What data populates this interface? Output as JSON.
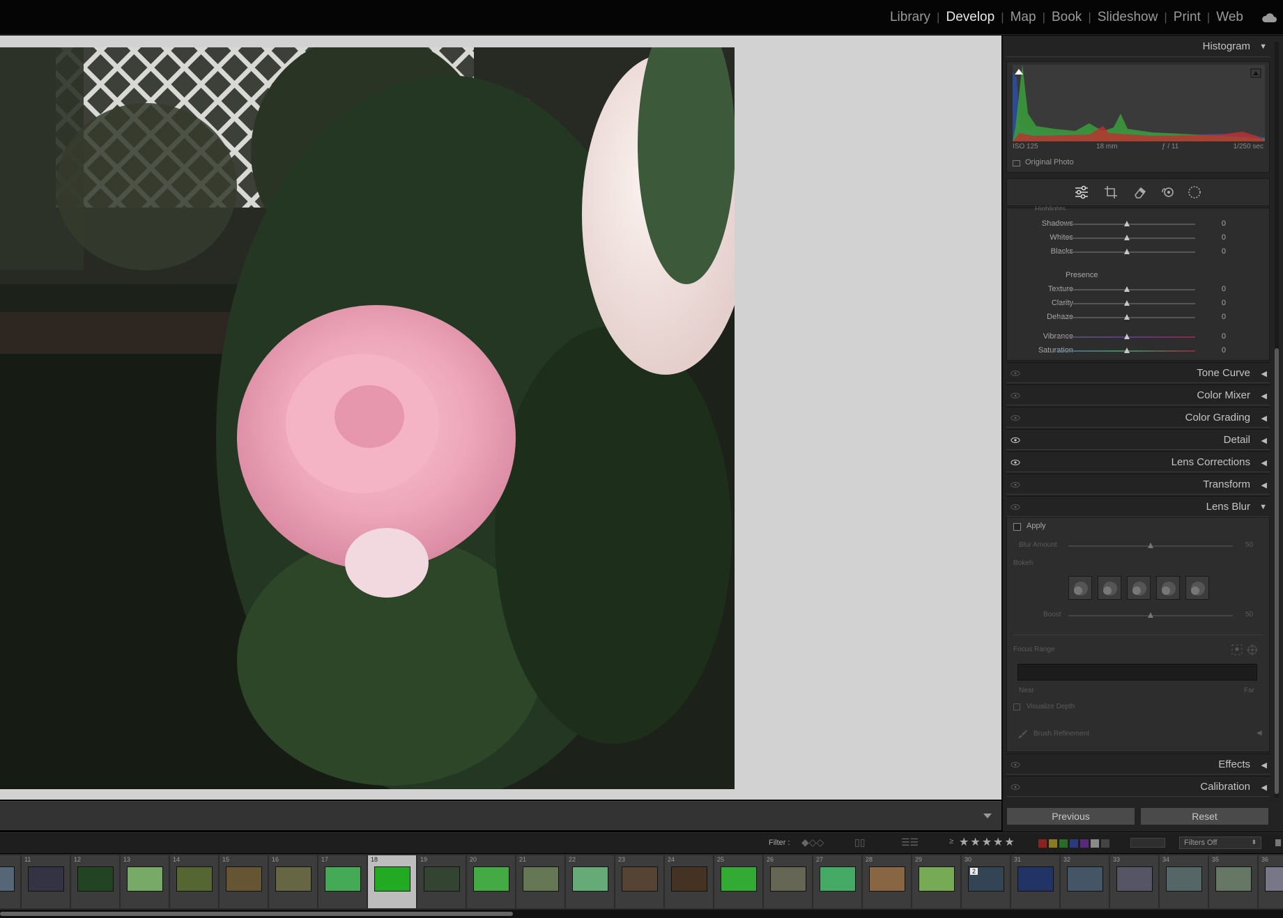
{
  "modules": [
    {
      "label": "Library",
      "active": false
    },
    {
      "label": "Develop",
      "active": true
    },
    {
      "label": "Map",
      "active": false
    },
    {
      "label": "Book",
      "active": false
    },
    {
      "label": "Slideshow",
      "active": false
    },
    {
      "label": "Print",
      "active": false
    },
    {
      "label": "Web",
      "active": false
    }
  ],
  "histogram": {
    "title": "Histogram",
    "iso": "ISO 125",
    "focal": "18 mm",
    "aperture": "ƒ / 11",
    "shutter": "1/250 sec",
    "original_photo": "Original Photo"
  },
  "basic": {
    "cut_label": "Highlights",
    "tone": [
      {
        "label": "Shadows",
        "value": "0"
      },
      {
        "label": "Whites",
        "value": "0"
      },
      {
        "label": "Blacks",
        "value": "0"
      }
    ],
    "presence_label": "Presence",
    "presence": [
      {
        "label": "Texture",
        "value": "0"
      },
      {
        "label": "Clarity",
        "value": "0"
      },
      {
        "label": "Dehaze",
        "value": "0"
      },
      {
        "label": "Vibrance",
        "value": "0"
      },
      {
        "label": "Saturation",
        "value": "0"
      }
    ]
  },
  "panels": {
    "tone_curve": "Tone Curve",
    "color_mixer": "Color Mixer",
    "color_grading": "Color Grading",
    "detail": "Detail",
    "lens_corrections": "Lens Corrections",
    "transform": "Transform",
    "lens_blur": "Lens Blur",
    "effects": "Effects",
    "calibration": "Calibration"
  },
  "lens_blur": {
    "apply": "Apply",
    "blur_amount": "Blur Amount",
    "blur_value": "50",
    "bokeh": "Bokeh",
    "boost": "Boost",
    "boost_value": "50",
    "focus_range": "Focus Range",
    "near": "Near",
    "far": "Far",
    "visualize_depth": "Visualize Depth",
    "brush_refinement": "Brush Refinement"
  },
  "buttons": {
    "previous": "Previous",
    "reset": "Reset"
  },
  "filter": {
    "label": "Filter :",
    "preset": "Filters Off"
  },
  "filmstrip": {
    "numbers": [
      "",
      "11",
      "12",
      "13",
      "14",
      "15",
      "16",
      "17",
      "18",
      "19",
      "20",
      "21",
      "22",
      "23",
      "24",
      "25",
      "26",
      "27",
      "28",
      "29",
      "30",
      "31",
      "32",
      "33",
      "34",
      "35",
      "36"
    ],
    "selected": "18",
    "stack_badge": "2"
  },
  "colors": {
    "accent": "#e8e8e8",
    "panel": "#232323",
    "canvas": "#d2d2d2"
  }
}
